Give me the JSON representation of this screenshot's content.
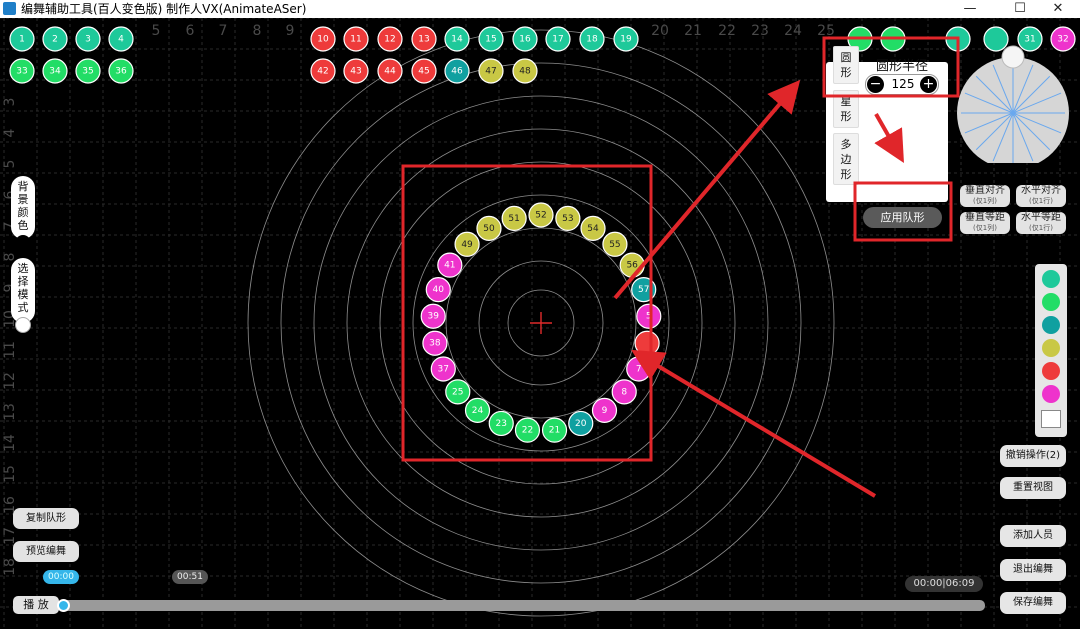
{
  "window": {
    "title": "编舞辅助工具(百人变色版)  制作人VX(AnimateASer)",
    "minimize_icon": "—",
    "maximize_icon": "☐",
    "close_icon": "✕"
  },
  "grid": {
    "top_numbers": [
      "5",
      "6",
      "7",
      "8",
      "9",
      "20",
      "21",
      "22",
      "23",
      "24",
      "25"
    ],
    "left_numbers": [
      "3",
      "4",
      "5",
      "6",
      "7",
      "8",
      "9",
      "10",
      "11",
      "12",
      "13",
      "14",
      "15",
      "16",
      "17",
      "18"
    ]
  },
  "colors": {
    "teal": "#1ec99a",
    "green": "#22dd66",
    "cyan": "#10a0a0",
    "yellow": "#c9c845",
    "red": "#ee3b3b",
    "magenta": "#ee33cc",
    "annotation_red": "#e0262a"
  },
  "palette_dancers": [
    {
      "label": "1",
      "color": "teal"
    },
    {
      "label": "2",
      "color": "teal"
    },
    {
      "label": "3",
      "color": "teal"
    },
    {
      "label": "4",
      "color": "teal"
    },
    {
      "label": "10",
      "color": "red"
    },
    {
      "label": "11",
      "color": "red"
    },
    {
      "label": "12",
      "color": "red"
    },
    {
      "label": "13",
      "color": "red"
    },
    {
      "label": "14",
      "color": "teal"
    },
    {
      "label": "15",
      "color": "teal"
    },
    {
      "label": "16",
      "color": "teal"
    },
    {
      "label": "17",
      "color": "teal"
    },
    {
      "label": "18",
      "color": "teal"
    },
    {
      "label": "19",
      "color": "teal"
    },
    {
      "label": "33",
      "color": "green"
    },
    {
      "label": "34",
      "color": "green"
    },
    {
      "label": "35",
      "color": "green"
    },
    {
      "label": "36",
      "color": "green"
    },
    {
      "label": "42",
      "color": "red"
    },
    {
      "label": "43",
      "color": "red"
    },
    {
      "label": "44",
      "color": "red"
    },
    {
      "label": "45",
      "color": "red"
    },
    {
      "label": "46",
      "color": "cyan"
    },
    {
      "label": "47",
      "color": "yellow"
    },
    {
      "label": "48",
      "color": "yellow"
    },
    {
      "label": "",
      "color": "green"
    },
    {
      "label": "",
      "color": "green"
    },
    {
      "label": "",
      "color": "teal"
    },
    {
      "label": "",
      "color": "teal"
    },
    {
      "label": "31",
      "color": "teal"
    },
    {
      "label": "32",
      "color": "magenta"
    }
  ],
  "circle_dancers": [
    {
      "label": "52",
      "color": "yellow"
    },
    {
      "label": "53",
      "color": "yellow"
    },
    {
      "label": "54",
      "color": "yellow"
    },
    {
      "label": "55",
      "color": "yellow"
    },
    {
      "label": "56",
      "color": "yellow"
    },
    {
      "label": "57",
      "color": "cyan"
    },
    {
      "label": "5",
      "color": "magenta"
    },
    {
      "label": "",
      "color": "red"
    },
    {
      "label": "7",
      "color": "magenta"
    },
    {
      "label": "8",
      "color": "magenta"
    },
    {
      "label": "9",
      "color": "magenta"
    },
    {
      "label": "20",
      "color": "cyan"
    },
    {
      "label": "21",
      "color": "green"
    },
    {
      "label": "22",
      "color": "green"
    },
    {
      "label": "23",
      "color": "green"
    },
    {
      "label": "24",
      "color": "green"
    },
    {
      "label": "25",
      "color": "green"
    },
    {
      "label": "37",
      "color": "magenta"
    },
    {
      "label": "38",
      "color": "magenta"
    },
    {
      "label": "39",
      "color": "magenta"
    },
    {
      "label": "40",
      "color": "magenta"
    },
    {
      "label": "41",
      "color": "magenta"
    },
    {
      "label": "49",
      "color": "yellow"
    },
    {
      "label": "50",
      "color": "yellow"
    },
    {
      "label": "51",
      "color": "yellow"
    }
  ],
  "shape_tabs": {
    "circle": "圆\n形",
    "star": "星\n形",
    "polygon": "多\n边\n形"
  },
  "radius": {
    "title": "圆形半径",
    "value": "125",
    "minus": "−",
    "plus": "+"
  },
  "apply_button": "应用队形",
  "align": {
    "vertical_align": "垂直对齐",
    "horizontal_align": "水平对齐",
    "vertical_spacing": "垂直等距",
    "horizontal_spacing": "水平等距",
    "by_column": "(仅1列)",
    "by_row": "(仅1行)"
  },
  "right_buttons": {
    "undo": "撤销操作(2)",
    "reset_view": "重置视图",
    "add_person": "添加人员",
    "exit_edit": "退出编舞",
    "save_edit": "保存编舞"
  },
  "left_toggles": {
    "background_color": "背\n景\n颜\n色",
    "select_mode": "选\n择\n模\n式"
  },
  "left_buttons": {
    "copy_formation": "复制队形",
    "preview": "预览编舞"
  },
  "timeline": {
    "play": "播 放",
    "marker_start": "00:00",
    "marker_keyframe": "00:51",
    "time_display": "00:00|06:09",
    "progress": 0
  }
}
